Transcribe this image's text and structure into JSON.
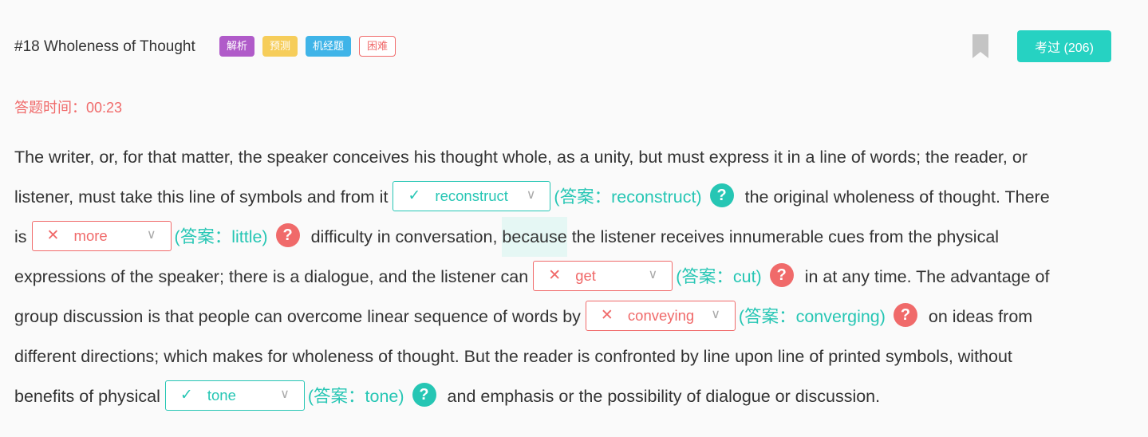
{
  "header": {
    "title": "#18 Wholeness of Thought",
    "badges": [
      "解析",
      "预测",
      "机经题",
      "困难"
    ],
    "pass_label": "考过 (206)"
  },
  "timer": "答题时间：00:23",
  "passage": {
    "l1": "The writer, or, for that matter, the speaker conceives his thought whole, as a unity, but must express it in a line of words; the reader, or",
    "l2a": "listener, must take this line of symbols and from it",
    "l2b": "the original wholeness of thought. There",
    "l3a": "is",
    "l3b": "difficulty in conversation,",
    "l3c": "because",
    "l3d": "the listener receives innumerable cues from the physical",
    "l4a": "expressions of the speaker; there is a dialogue, and the listener can",
    "l4b": "in at any time. The advantage of",
    "l5a": "group discussion is that people can overcome linear sequence of words by",
    "l5b": "on ideas from",
    "l6": "different directions; which makes for wholeness of thought. But the reader is confronted by line upon line of printed symbols, without",
    "l7a": "benefits of physical",
    "l7b": "and emphasis or the possibility of dialogue or discussion."
  },
  "blanks": [
    {
      "selected": "reconstruct",
      "answer": "(答案：reconstruct)",
      "mark": "✓",
      "status": "correct"
    },
    {
      "selected": "more",
      "answer": "(答案：little)",
      "mark": "✕",
      "status": "wrong"
    },
    {
      "selected": "get",
      "answer": "(答案：cut)",
      "mark": "✕",
      "status": "wrong"
    },
    {
      "selected": "conveying",
      "answer": "(答案：converging)",
      "mark": "✕",
      "status": "wrong"
    },
    {
      "selected": "tone",
      "answer": "(答案：tone)",
      "mark": "✓",
      "status": "correct"
    }
  ],
  "glyphs": {
    "chevron": "∨",
    "help": "?"
  },
  "colors": {
    "accent": "#26d2c2",
    "error": "#f06a6a",
    "purple": "#b05bc9",
    "yellow": "#f6cd5a",
    "blue": "#3fb4e8"
  }
}
